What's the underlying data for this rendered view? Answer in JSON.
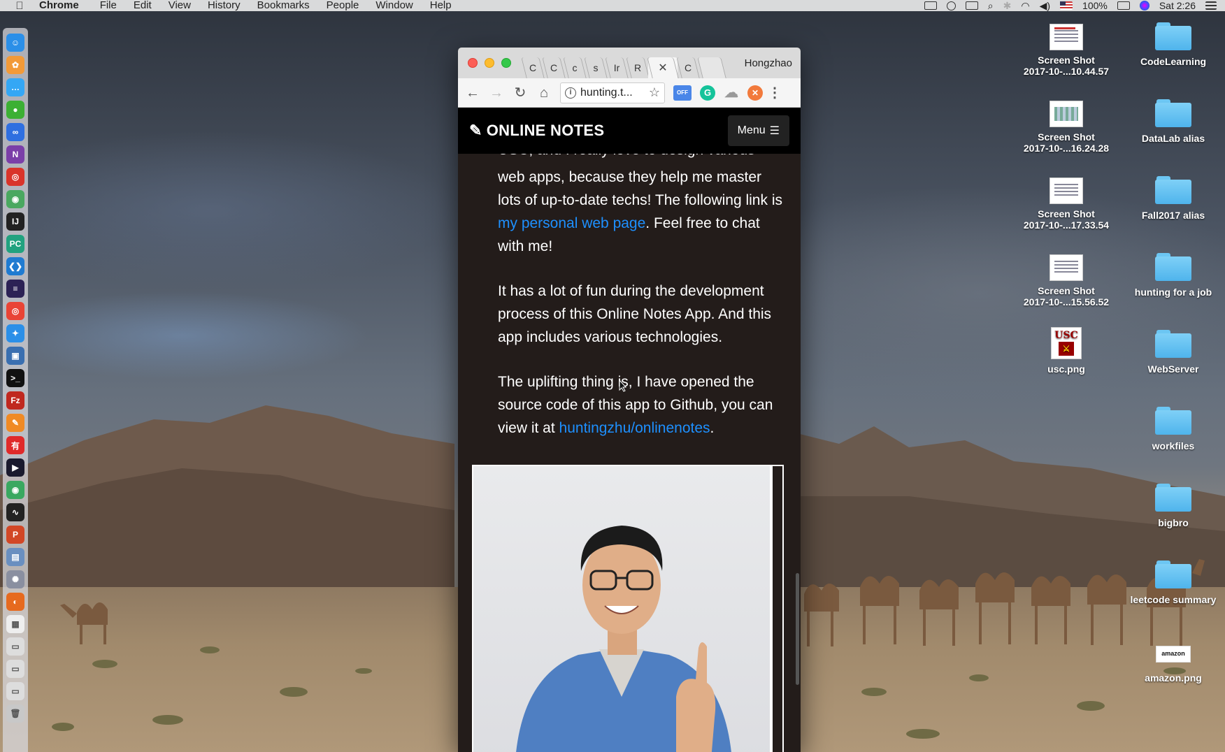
{
  "menubar": {
    "app_name": "Chrome",
    "items": [
      "File",
      "Edit",
      "View",
      "History",
      "Bookmarks",
      "People",
      "Window",
      "Help"
    ],
    "battery": "100%",
    "clock": "Sat 2:26"
  },
  "dock": {
    "apps": [
      {
        "icon": "finder-icon",
        "color": "#2b8fe8",
        "glyph": "☺"
      },
      {
        "icon": "photos-icon",
        "color": "#f29a38",
        "glyph": "✿"
      },
      {
        "icon": "messages-icon",
        "color": "#34a7f5",
        "glyph": "…"
      },
      {
        "icon": "wechat-icon",
        "color": "#3cb034",
        "glyph": "●"
      },
      {
        "icon": "baidu-icon",
        "color": "#2f6fe0",
        "glyph": "∞"
      },
      {
        "icon": "onenote-icon",
        "color": "#7b3fa8",
        "glyph": "N"
      },
      {
        "icon": "netease-music-icon",
        "color": "#d9342a",
        "glyph": "◎"
      },
      {
        "icon": "app-icon",
        "color": "#4aa860",
        "glyph": "◉"
      },
      {
        "icon": "intellij-icon",
        "color": "#222222",
        "glyph": "IJ"
      },
      {
        "icon": "pycharm-icon",
        "color": "#21a27f",
        "glyph": "PC"
      },
      {
        "icon": "vscode-icon",
        "color": "#1f7bd1",
        "glyph": "❮❯"
      },
      {
        "icon": "eclipse-icon",
        "color": "#2c2255",
        "glyph": "≡"
      },
      {
        "icon": "chrome-icon",
        "color": "#e94436",
        "glyph": "◎"
      },
      {
        "icon": "safari-icon",
        "color": "#2b8fe8",
        "glyph": "✦"
      },
      {
        "icon": "virtualbox-icon",
        "color": "#3a6fb0",
        "glyph": "▣"
      },
      {
        "icon": "terminal-icon",
        "color": "#111111",
        "glyph": ">_"
      },
      {
        "icon": "filezilla-icon",
        "color": "#c0281f",
        "glyph": "Fz"
      },
      {
        "icon": "sublime-icon",
        "color": "#f08a24",
        "glyph": "✎"
      },
      {
        "icon": "youdao-icon",
        "color": "#e02a2a",
        "glyph": "有"
      },
      {
        "icon": "quicktime-icon",
        "color": "#1a1a2e",
        "glyph": "▶"
      },
      {
        "icon": "app-icon",
        "color": "#3aa860",
        "glyph": "◉"
      },
      {
        "icon": "activity-monitor-icon",
        "color": "#222222",
        "glyph": "∿"
      },
      {
        "icon": "powerpoint-icon",
        "color": "#d24726",
        "glyph": "P"
      },
      {
        "icon": "preview-icon",
        "color": "#6a8fc0",
        "glyph": "▤"
      },
      {
        "icon": "launchpad-icon",
        "color": "#8a8fa0",
        "glyph": "✺"
      },
      {
        "icon": "firefox-icon",
        "color": "#e66a1f",
        "glyph": "◐"
      },
      {
        "icon": "document-icon",
        "color": "#eeeeee",
        "glyph": "▦"
      },
      {
        "icon": "image-icon",
        "color": "#dddddd",
        "glyph": "▭"
      },
      {
        "icon": "image-icon",
        "color": "#dddddd",
        "glyph": "▭"
      },
      {
        "icon": "image-icon",
        "color": "#dddddd",
        "glyph": "▭"
      },
      {
        "icon": "trash-icon",
        "color": "#c8c8c8",
        "glyph": "🗑"
      }
    ]
  },
  "desktop": {
    "screenshots": [
      {
        "line1": "Screen Shot",
        "line2": "2017-10-...10.44.57",
        "style": "red"
      },
      {
        "line1": "Screen Shot",
        "line2": "2017-10-...16.24.28",
        "style": "green"
      },
      {
        "line1": "Screen Shot",
        "line2": "2017-10-...17.33.54",
        "style": "plain"
      },
      {
        "line1": "Screen Shot",
        "line2": "2017-10-...15.56.52",
        "style": "plain"
      }
    ],
    "usc_file": "usc.png",
    "usc_logo_text": "USC",
    "folders": [
      "CodeLearning",
      "DataLab alias",
      "Fall2017 alias",
      "hunting for a job",
      "WebServer",
      "workfiles",
      "bigbro",
      "leetcode summary"
    ],
    "amazon_file": "amazon.png",
    "amazon_logo_text": "amazon"
  },
  "browser": {
    "tabs": [
      "C",
      "C",
      "c",
      "s",
      "Ir",
      "R",
      "",
      "C"
    ],
    "active_tab_index": 6,
    "profile": "Hongzhao",
    "url": "hunting.t...",
    "ext_off_label_top": "",
    "ext_off_label": "OFF"
  },
  "site": {
    "brand": "ONLINE NOTES",
    "menu_label": "Menu",
    "para0": "USC, and I really love to design various",
    "para1_a": "web apps, because they help me master lots of up-to-date techs! The following link is ",
    "para1_link": "my personal web page",
    "para1_b": ". Feel free to chat with me!",
    "para2": "It has a lot of fun during the development process of this Online Notes App. And this app includes various technologies.",
    "para3_a": "The uplifting thing is, I have opened the source code of this app to Github, you can view it at ",
    "para3_link": "huntingzhu/onlinenotes",
    "para3_b": "."
  },
  "colors": {
    "link": "#1e90ff",
    "navbar": "#000000",
    "content_bg": "#231c1a"
  }
}
